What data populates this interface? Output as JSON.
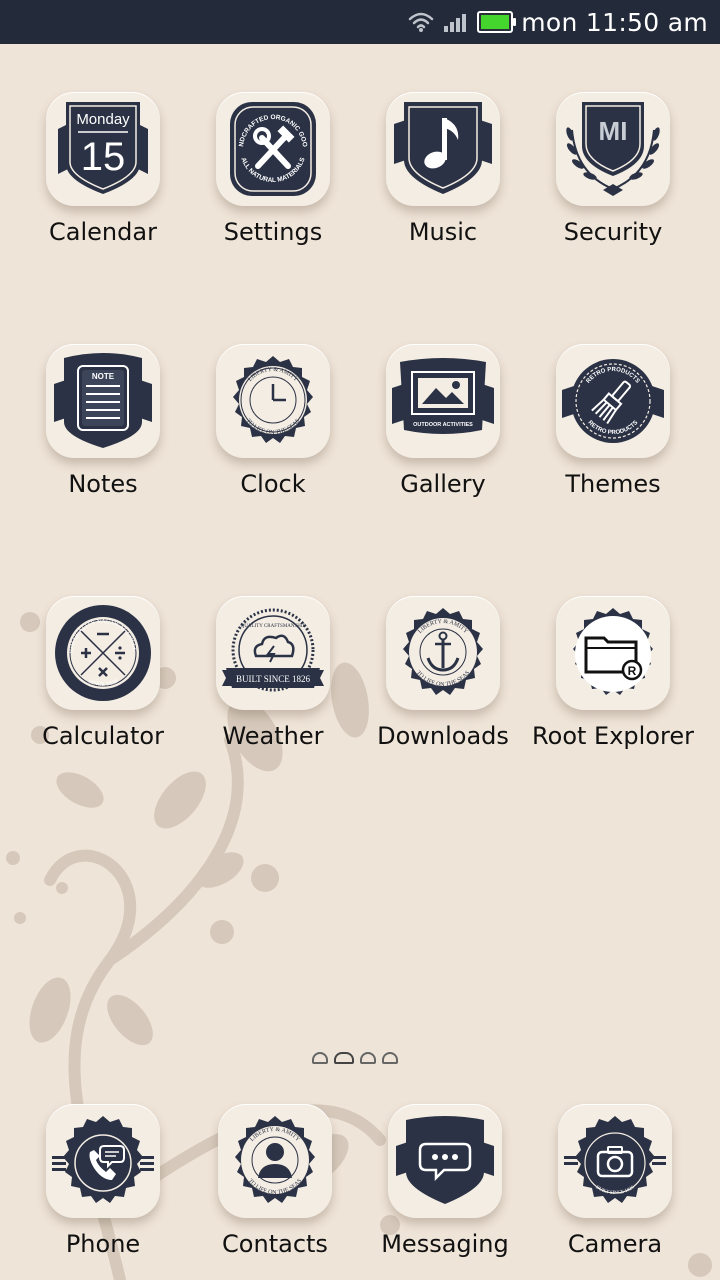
{
  "status_bar": {
    "time_text": "mon 11:50 am",
    "battery_level": 1.0,
    "wifi": "wifi-icon",
    "signal": "signal-icon"
  },
  "colors": {
    "badge": "#2b3245",
    "tile": "#f4ede3",
    "background": "#efe4d8",
    "battery": "#44d62c"
  },
  "apps": [
    {
      "label": "Calendar",
      "icon": "calendar-icon",
      "day": "Monday",
      "date": "15"
    },
    {
      "label": "Settings",
      "icon": "settings-icon",
      "arc_top": "HANDCRAFTED ORGANIC GOODS",
      "arc_bottom": "ALL NATURAL MATERIALS"
    },
    {
      "label": "Music",
      "icon": "music-note-icon"
    },
    {
      "label": "Security",
      "icon": "security-icon",
      "logo_text": "MI"
    },
    {
      "label": "Notes",
      "icon": "notes-icon",
      "note_text": "NOTE"
    },
    {
      "label": "Clock",
      "icon": "clock-icon",
      "arc_top": "LIBERTY & AMITY",
      "arc_bottom": "TO LIFE ON THE SEAS"
    },
    {
      "label": "Gallery",
      "icon": "gallery-icon",
      "banner": "OUTDOOR ACTIVITIES"
    },
    {
      "label": "Themes",
      "icon": "brush-icon",
      "arc_top": "RETRO PRODUCTS",
      "arc_bottom": "RETRO PRODUCTS"
    },
    {
      "label": "Calculator",
      "icon": "calculator-icon",
      "arc_top": "PREMIUM QUALITY NAUTICAL COLLECTION",
      "arc_bottom": "SINCE 1839"
    },
    {
      "label": "Weather",
      "icon": "weather-icon",
      "top_text": "QUALITY CRAFTSMANSHIP",
      "ribbon": "BUILT SINCE 1826"
    },
    {
      "label": "Downloads",
      "icon": "anchor-icon",
      "arc_top": "LIBERTY & AMITY",
      "arc_bottom": "TO LIFE ON THE SEAS"
    },
    {
      "label": "Root Explorer",
      "icon": "root-explorer-icon"
    }
  ],
  "pager": {
    "pages": 4,
    "current": 2
  },
  "dock": [
    {
      "label": "Phone",
      "icon": "phone-icon"
    },
    {
      "label": "Contacts",
      "icon": "contacts-icon",
      "arc_top": "LIBERTY & AMITY",
      "arc_bottom": "TO LIFE ON THE SEAS"
    },
    {
      "label": "Messaging",
      "icon": "message-icon"
    },
    {
      "label": "Camera",
      "icon": "camera-icon",
      "arc_bottom": "BUILT SINCE 1826"
    }
  ]
}
